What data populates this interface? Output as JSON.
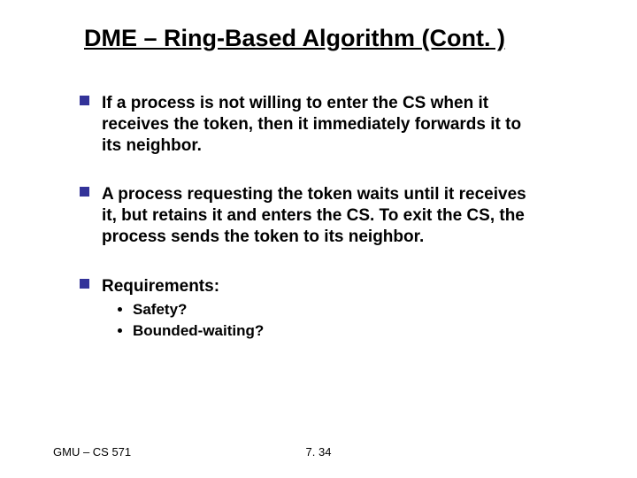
{
  "title": "DME – Ring-Based Algorithm (Cont. )",
  "bullets": [
    {
      "text": "If a process is not willing to enter the CS when it receives the token, then it immediately forwards it to its neighbor."
    },
    {
      "text": "A process requesting the token waits until it receives it, but retains it and enters the CS. To exit the CS, the process sends the token to its neighbor."
    },
    {
      "text": "Requirements:",
      "sub": [
        "Safety?",
        "Bounded-waiting?"
      ]
    }
  ],
  "footer": {
    "left": "GMU – CS 571",
    "center": "7. 34"
  }
}
